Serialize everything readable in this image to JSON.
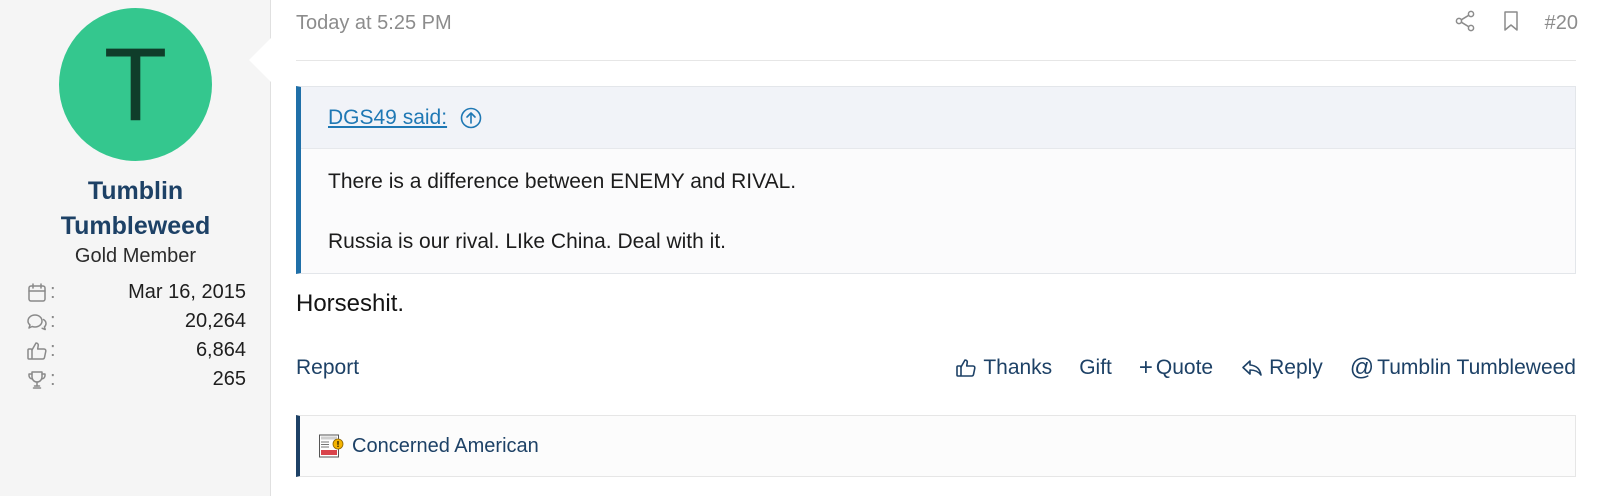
{
  "user": {
    "avatar_letter": "T",
    "name_line1": "Tumblin",
    "name_line2": "Tumbleweed",
    "title": "Gold Member",
    "stats": [
      {
        "icon": "calendar-icon",
        "value": "Mar 16, 2015"
      },
      {
        "icon": "messages-icon",
        "value": "20,264"
      },
      {
        "icon": "thumbs-up-icon",
        "value": "6,864"
      },
      {
        "icon": "trophy-icon",
        "value": "265"
      }
    ],
    "stat_separator": ":"
  },
  "post": {
    "date": "Today at 5:25 PM",
    "number": "#20",
    "header_icons": [
      "share-icon",
      "bookmark-icon"
    ],
    "quote": {
      "attribution": "DGS49 said:",
      "lines": [
        "There is a difference between ENEMY and RIVAL.",
        "Russia is our rival. LIke China. Deal with it."
      ]
    },
    "body": "Horseshit."
  },
  "actions": {
    "report": "Report",
    "thanks": "Thanks",
    "gift": "Gift",
    "quote_glyph": "+",
    "quote": "Quote",
    "reply": "Reply",
    "mention_glyph": "@",
    "mention": "Tumblin Tumbleweed"
  },
  "reactions": {
    "icon": "news-badge-icon",
    "name": "Concerned American"
  },
  "colors": {
    "avatar_bg": "#34c78e",
    "link": "#1d4166",
    "quote_accent": "#1f6fa8"
  }
}
